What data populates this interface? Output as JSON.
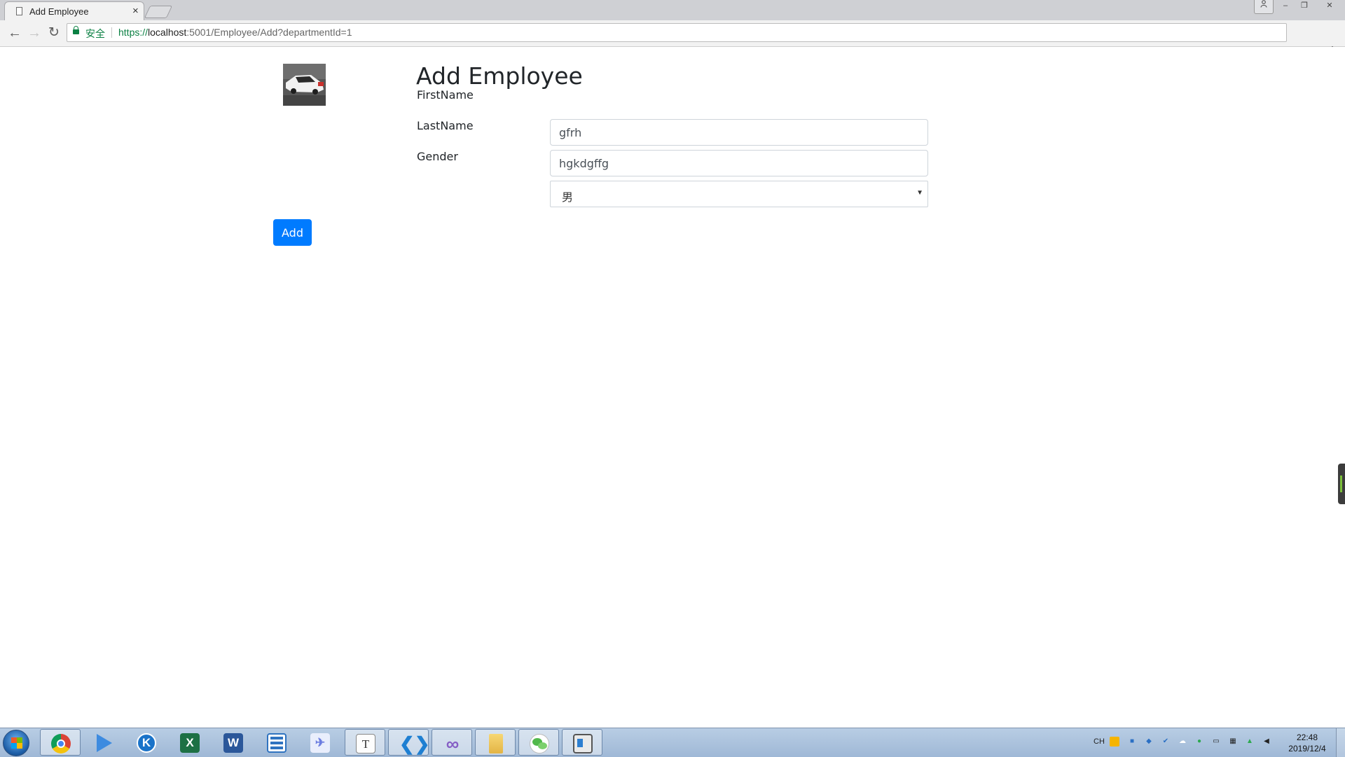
{
  "browser": {
    "tab_title": "Add Employee",
    "tab_close": "×",
    "security_label": "安全",
    "url_scheme": "https://",
    "url_host": "localhost",
    "url_rest": ":5001/Employee/Add?departmentId=1",
    "window_controls": {
      "minimize": "–",
      "restore": "❐",
      "close": "✕"
    }
  },
  "page": {
    "heading": "Add Employee",
    "form": {
      "first_name_label": "FirstName",
      "first_name_value": "gfrh",
      "last_name_label": "LastName",
      "last_name_value": "hgkdgffg",
      "gender_label": "Gender",
      "gender_selected": "男",
      "submit_label": "Add"
    },
    "colors": {
      "primary": "#007bff",
      "secure_green": "#0b8043"
    }
  },
  "taskbar": {
    "apps": [
      "chrome",
      "media-player",
      "kugou",
      "excel",
      "word",
      "list-app",
      "bird-app",
      "typora",
      "vscode",
      "visual-studio",
      "file-explorer",
      "wechat",
      "whiteboard"
    ],
    "tray_lang": "CH",
    "clock_time": "22:48",
    "clock_date": "2019/12/4"
  }
}
